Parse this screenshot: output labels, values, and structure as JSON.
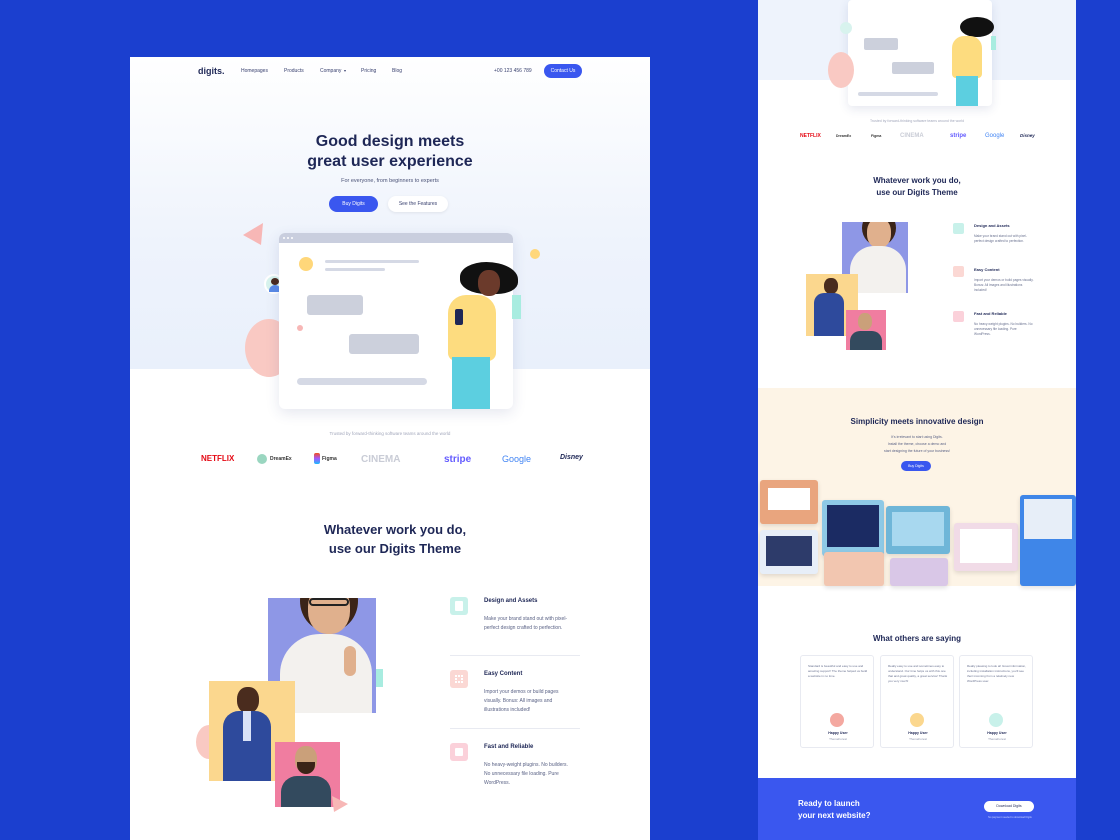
{
  "nav": {
    "logo": "digits.",
    "links": [
      "Homepages",
      "Products",
      "Company",
      "Pricing",
      "Blog"
    ],
    "phone": "+00 123 456 789",
    "cta": "Contact Us"
  },
  "hero": {
    "title_line1": "Good design meets",
    "title_line2": "great user experience",
    "subtitle": "For everyone, from beginners to experts",
    "primary_button": "Buy Digits",
    "secondary_button": "See the Features"
  },
  "logos": {
    "caption": "Trusted by forward-thinking software teams around the world",
    "brands": [
      "NETFLIX",
      "DreamEx",
      "Figma",
      "CINEMA",
      "stripe",
      "Google",
      "Disney"
    ]
  },
  "features_section": {
    "title_line1": "Whatever work you do,",
    "title_line2": "use our Digits Theme",
    "items": [
      {
        "title": "Design and Assets",
        "text": "Make your brand stand out with pixel-perfect design crafted to perfection."
      },
      {
        "title": "Easy Content",
        "text": "Import your demos or build pages visually. Bonus: All images and illustrations included!"
      },
      {
        "title": "Fast and Reliable",
        "text": "No heavy-weight plugins. No builders. No unnecessary file loading. Pure WordPress."
      }
    ]
  },
  "right_page": {
    "simplicity_title": "Simplicity meets innovative design",
    "simplicity_text_1": "It's irrelevant to start using Digits.",
    "simplicity_text_2": "Install the theme, choose a demo and",
    "simplicity_text_3": "start designing the future of your business!",
    "simplicity_button": "Buy Digits",
    "testimonials_title": "What others are saying",
    "testimonials": [
      {
        "text": "Standard is beautiful and easy to use and amazing support! The theme helped us build a website in no time.",
        "name": "Happy User",
        "role": "ThemeForest"
      },
      {
        "text": "Really easy to use and sometimes easy to understand. Our time helps us with this one that and great quality, a great service! Thank you very much!",
        "name": "Happy User",
        "role": "ThemeForest"
      },
      {
        "text": "Really pleasing to look at! Great information, including installation instructions, you'll see their incoming from a relatively new WordPress user.",
        "name": "Happy User",
        "role": "ThemeForest"
      }
    ],
    "cta_line1": "Ready to launch",
    "cta_line2": "your next website?",
    "cta_button": "Download Digits",
    "cta_note": "No payment needed to download Digits"
  },
  "colors": {
    "background": "#1b3fcf",
    "primary": "#3a57ef",
    "heading": "#1e2756"
  }
}
